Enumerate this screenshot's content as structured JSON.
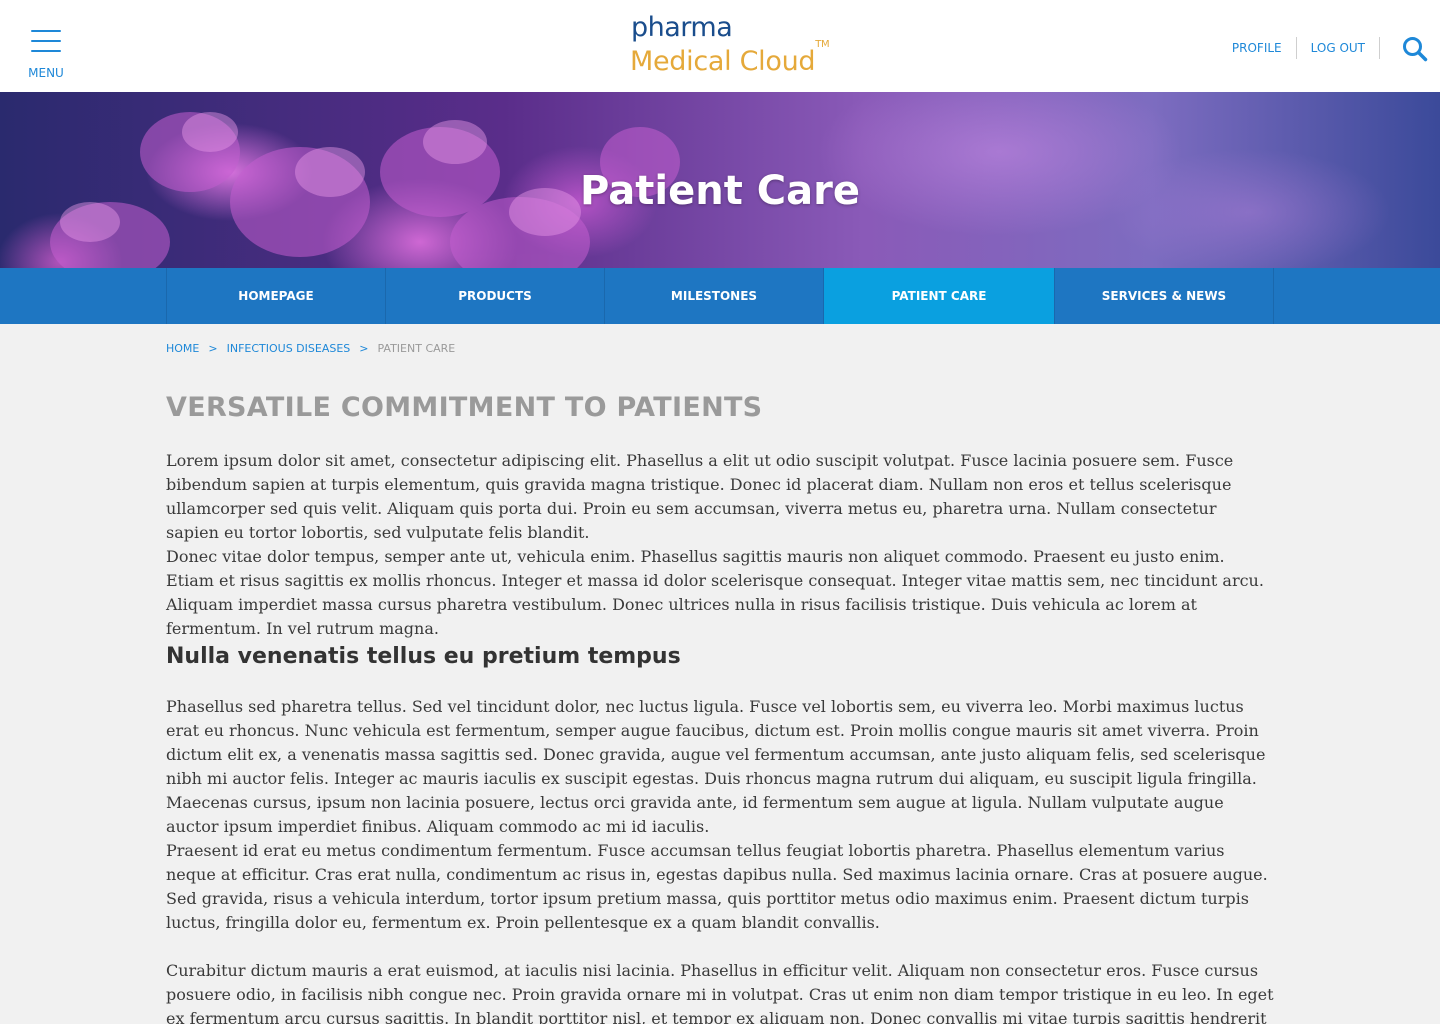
{
  "header": {
    "menu_label": "MENU",
    "logo_top": "pharma",
    "logo_bottom": "Medical Cloud",
    "logo_tm": "TM",
    "profile_label": "PROFILE",
    "logout_label": "LOG OUT",
    "icons": {
      "menu": "hamburger-icon",
      "search": "search-icon"
    }
  },
  "hero": {
    "title": "Patient Care"
  },
  "nav": {
    "items": [
      {
        "label": "HOMEPAGE",
        "active": false
      },
      {
        "label": "PRODUCTS",
        "active": false
      },
      {
        "label": "MILESTONES",
        "active": false
      },
      {
        "label": "PATIENT CARE",
        "active": true
      },
      {
        "label": "SERVICES & NEWS",
        "active": false
      }
    ]
  },
  "breadcrumb": {
    "items": [
      "HOME",
      "INFECTIOUS DISEASES",
      "PATIENT CARE"
    ],
    "separator": ">"
  },
  "content": {
    "heading": "VERSATILE COMMITMENT TO PATIENTS",
    "paragraphs": [
      "Lorem ipsum dolor sit amet, consectetur adipiscing elit. Phasellus a elit ut odio suscipit volutpat. Fusce lacinia posuere sem. Fusce bibendum sapien at turpis elementum, quis gravida magna tristique. Donec id placerat diam. Nullam non eros et tellus scelerisque ullamcorper sed quis velit. Aliquam quis porta dui. Proin eu sem accumsan, viverra metus eu, pharetra urna. Nullam consectetur sapien eu tortor lobortis, sed vulputate felis blandit.",
      "Donec vitae dolor tempus, semper ante ut, vehicula enim. Phasellus sagittis mauris non aliquet commodo. Praesent eu justo enim. Etiam et risus sagittis ex mollis rhoncus. Integer et massa id dolor scelerisque consequat. Integer vitae mattis sem, nec tincidunt arcu. Aliquam imperdiet massa cursus pharetra vestibulum. Donec ultrices nulla in risus facilisis tristique. Duis vehicula ac lorem at fermentum. In vel rutrum magna."
    ],
    "subheading": "Nulla venenatis tellus eu pretium tempus",
    "paragraphs2": [
      "Phasellus sed pharetra tellus. Sed vel tincidunt dolor, nec luctus ligula. Fusce vel lobortis sem, eu viverra leo. Morbi maximus luctus erat eu rhoncus. Nunc vehicula est fermentum, semper augue faucibus, dictum est. Proin mollis congue mauris sit amet viverra. Proin dictum elit ex, a venenatis massa sagittis sed. Donec gravida, augue vel fermentum accumsan, ante justo aliquam felis, sed scelerisque nibh mi auctor felis. Integer ac mauris iaculis ex suscipit egestas. Duis rhoncus magna rutrum dui aliquam, eu suscipit ligula fringilla. Maecenas cursus, ipsum non lacinia posuere, lectus orci gravida ante, id fermentum sem augue at ligula. Nullam vulputate augue auctor ipsum imperdiet finibus. Aliquam commodo ac mi id iaculis.",
      "Praesent id erat eu metus condimentum fermentum. Fusce accumsan tellus feugiat lobortis pharetra. Phasellus elementum varius neque at efficitur. Cras erat nulla, condimentum ac risus in, egestas dapibus nulla. Sed maximus lacinia ornare. Cras at posuere augue. Sed gravida, risus a vehicula interdum, tortor ipsum pretium massa, quis porttitor metus odio maximus enim. Praesent dictum turpis luctus, fringilla dolor eu, fermentum ex. Proin pellentesque ex a quam blandit convallis.",
      "Curabitur dictum mauris a erat euismod, at iaculis nisi lacinia. Phasellus in efficitur velit. Aliquam non consectetur eros. Fusce cursus posuere odio, in facilisis nibh congue nec. Proin gravida ornare mi in volutpat. Cras ut enim non diam tempor tristique in eu leo. In eget ex fermentum arcu cursus sagittis. In blandit porttitor nisl, et tempor ex aliquam non. Donec convallis mi vitae turpis sagittis hendrerit sit amet id nisl. Nunc quis massa est. Aenean fringilla aliquet velit non"
    ]
  },
  "colors": {
    "accent": "#1e88d8",
    "nav_bg": "#1e76c2",
    "nav_active": "#0aa0e0",
    "logo_blue": "#1a4d8c",
    "logo_gold": "#e5a93a",
    "heading_gray": "#9a9a9a",
    "page_bg": "#f1f1f1"
  }
}
